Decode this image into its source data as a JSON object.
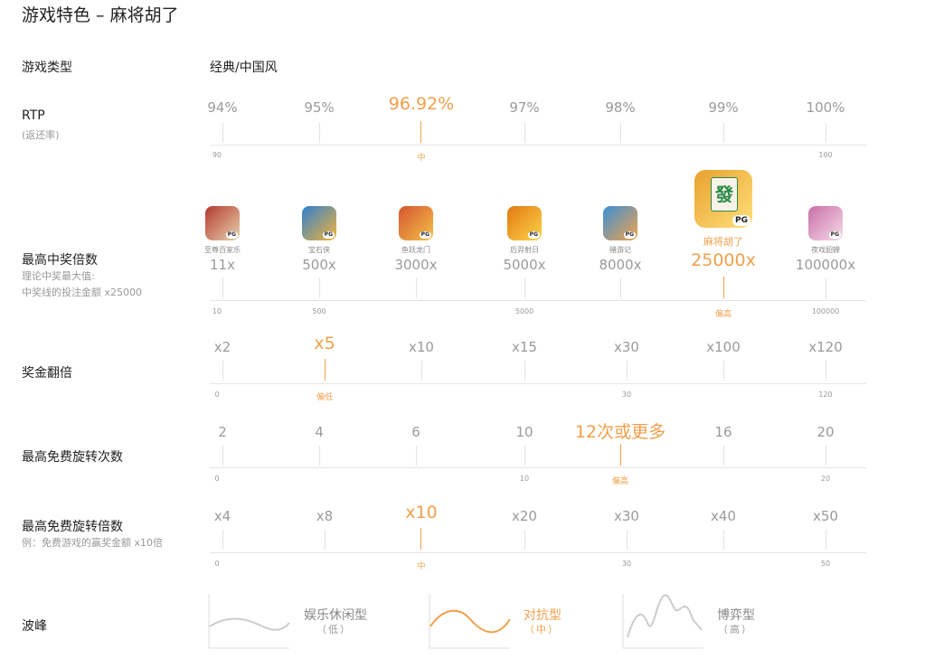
{
  "title": "游戏特色 – 麻将胡了",
  "game_type": {
    "label": "游戏类型",
    "value": "经典/中国风"
  },
  "rtp": {
    "label": "RTP",
    "sub": "(返还率)",
    "values": [
      "94%",
      "95%",
      "96.92%",
      "97%",
      "98%",
      "99%",
      "100%"
    ],
    "highlight_index": 2,
    "scale_left": "90",
    "scale_right": "100",
    "marker": "中"
  },
  "max_win": {
    "label": "最高中奖倍数",
    "sub1": "理论中奖最大值:",
    "sub2": "中奖线的投注金额 x25000",
    "games": [
      {
        "name": "至尊百家乐",
        "value": "11x",
        "colors": [
          "#b33a2e",
          "#e8d3b0"
        ]
      },
      {
        "name": "宝石侠",
        "value": "500x",
        "colors": [
          "#2f7fd0",
          "#f2b43a"
        ]
      },
      {
        "name": "鱼跃龙门",
        "value": "3000x",
        "colors": [
          "#d4552e",
          "#f6c04a"
        ]
      },
      {
        "name": "后羿射日",
        "value": "5000x",
        "colors": [
          "#e07a12",
          "#ffd34a"
        ]
      },
      {
        "name": "赌游记",
        "value": "8000x",
        "colors": [
          "#3a8fd8",
          "#f3a34a"
        ]
      },
      {
        "name": "麻将胡了",
        "value": "25000x",
        "colors": [
          "#e8a12f",
          "#ffe07a"
        ]
      },
      {
        "name": "夜戏貂蝉",
        "value": "100000x",
        "colors": [
          "#c86fa8",
          "#f6dbe8"
        ]
      }
    ],
    "highlight_index": 5,
    "pg": "PG",
    "mahjong_char": "發",
    "scale": [
      "10",
      "500",
      "5000",
      "100000"
    ],
    "marker": "偏高"
  },
  "multiplier": {
    "label": "奖金翻倍",
    "values": [
      "x2",
      "x5",
      "x10",
      "x15",
      "x30",
      "x100",
      "x120"
    ],
    "highlight_index": 1,
    "scale": [
      "0",
      "30",
      "120"
    ],
    "marker": "偏低"
  },
  "free_spins": {
    "label": "最高免费旋转次数",
    "values": [
      "2",
      "4",
      "6",
      "10",
      "12次或更多",
      "16",
      "20"
    ],
    "highlight_index": 4,
    "scale": [
      "0",
      "10",
      "20"
    ],
    "marker": "偏高"
  },
  "free_mult": {
    "label": "最高免费旋转倍数",
    "sub": "例：免费游戏的赢奖金额 x10倍",
    "values": [
      "x4",
      "x8",
      "x10",
      "x20",
      "x30",
      "x40",
      "x50"
    ],
    "highlight_index": 2,
    "scale": [
      "0",
      "30",
      "50"
    ],
    "marker": "中"
  },
  "volatility": {
    "label": "波峰",
    "types": [
      {
        "name": "娱乐休闲型",
        "level": "（低）"
      },
      {
        "name": "对抗型",
        "level": "（中）"
      },
      {
        "name": "博弈型",
        "level": "（高）"
      }
    ],
    "highlight_index": 1,
    "accent": "#f0a04b",
    "muted": "#cccccc"
  },
  "colors": {
    "accent": "#f0a04b",
    "text": "#222222",
    "muted": "#9a9a9a",
    "line": "#e6e6e6"
  }
}
